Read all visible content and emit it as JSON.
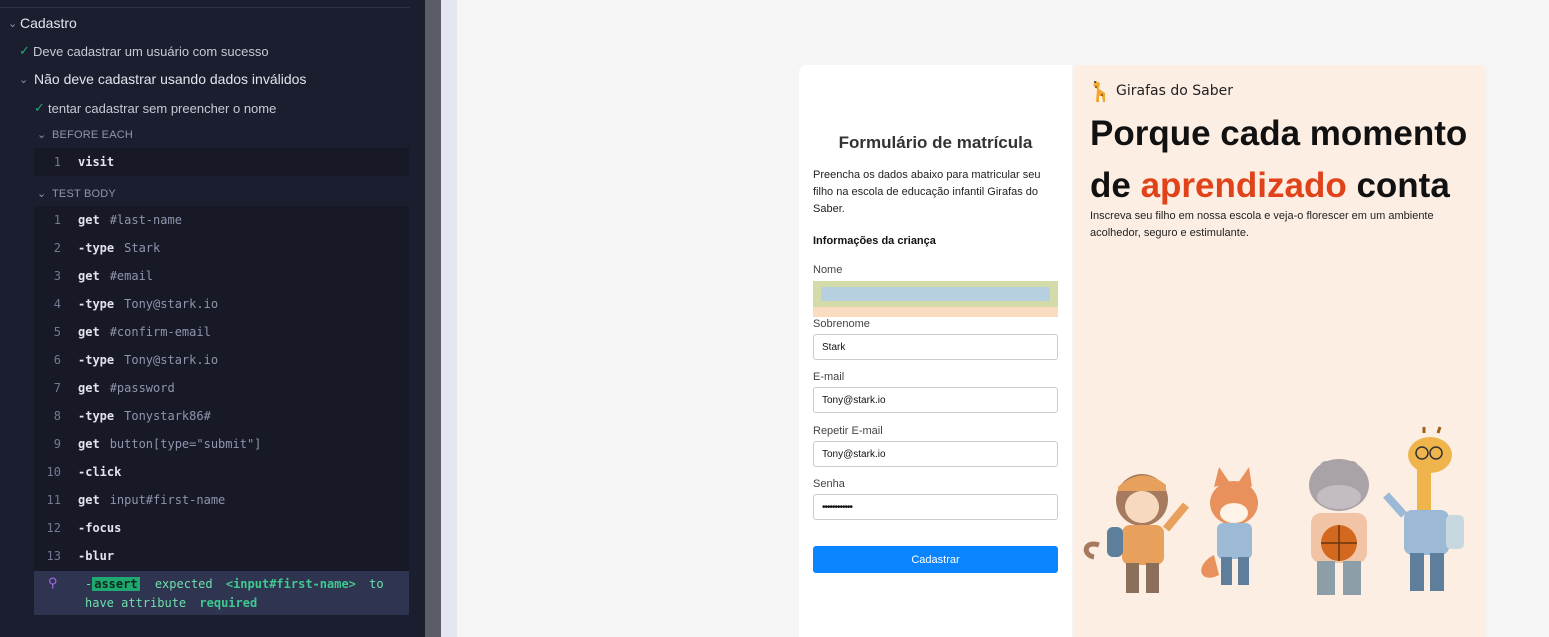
{
  "runner": {
    "suite_title": "Cadastro",
    "test1": "Deve cadastrar um usuário com sucesso",
    "suite2": "Não deve cadastrar usando dados inválidos",
    "test2": "tentar cadastrar sem preencher o nome",
    "before_each": "BEFORE EACH",
    "test_body": "TEST BODY",
    "before_cmds": [
      {
        "n": "1",
        "cmd": "visit",
        "arg": ""
      }
    ],
    "body_cmds": [
      {
        "n": "1",
        "cmd": "get",
        "arg": "#last-name"
      },
      {
        "n": "2",
        "cmd": "-type",
        "arg": "Stark"
      },
      {
        "n": "3",
        "cmd": "get",
        "arg": "#email"
      },
      {
        "n": "4",
        "cmd": "-type",
        "arg": "Tony@stark.io"
      },
      {
        "n": "5",
        "cmd": "get",
        "arg": "#confirm-email"
      },
      {
        "n": "6",
        "cmd": "-type",
        "arg": "Tony@stark.io"
      },
      {
        "n": "7",
        "cmd": "get",
        "arg": "#password"
      },
      {
        "n": "8",
        "cmd": "-type",
        "arg": "Tonystark86#"
      },
      {
        "n": "9",
        "cmd": "get",
        "arg": "button[type=\"submit\"]"
      },
      {
        "n": "10",
        "cmd": "-click",
        "arg": ""
      },
      {
        "n": "11",
        "cmd": "get",
        "arg": "input#first-name"
      },
      {
        "n": "12",
        "cmd": "-focus",
        "arg": ""
      },
      {
        "n": "13",
        "cmd": "-blur",
        "arg": ""
      }
    ],
    "assert": {
      "dash": "-",
      "keyword": "assert",
      "expected": "expected",
      "subject": "<input#first-name>",
      "to": "to",
      "have_attr": "have attribute",
      "attr": "required"
    },
    "colors": {
      "pass": "#1fa971",
      "pin": "#a06ce4"
    }
  },
  "form": {
    "title": "Formulário de matrícula",
    "description": "Preencha os dados abaixo para matricular seu filho na escola de educação infantil Girafas do Saber.",
    "section": "Informações da criança",
    "labels": {
      "first_name": "Nome",
      "last_name": "Sobrenome",
      "email": "E-mail",
      "confirm_email": "Repetir E-mail",
      "password": "Senha"
    },
    "values": {
      "first_name": "",
      "last_name": "Stark",
      "email": "Tony@stark.io",
      "confirm_email": "Tony@stark.io",
      "password": "••••••••••••"
    },
    "submit_label": "Cadastrar",
    "accent_color": "#0a84ff"
  },
  "hero": {
    "brand": "Girafas do Saber",
    "title_part1": "Porque cada momento",
    "title_part2": "de ",
    "title_accent": "aprendizado",
    "title_part3": " conta",
    "subtitle": "Inscreva seu filho em nossa escola e veja-o florescer em um ambiente acolhedor, seguro e estimulante.",
    "accent_color": "#e0421a",
    "illustration": "animal-characters-illustration"
  }
}
